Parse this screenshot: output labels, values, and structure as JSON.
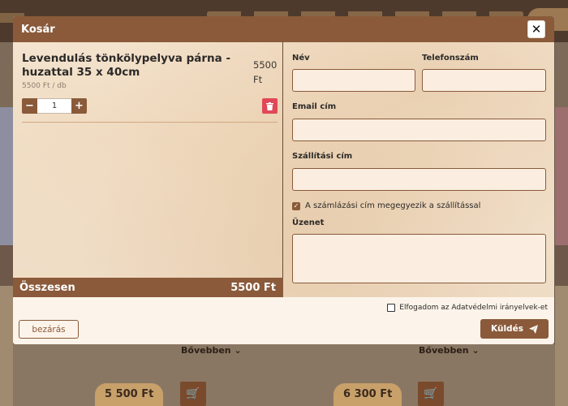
{
  "modal": {
    "title": "Kosár",
    "close_icon": "close-icon",
    "close_glyph": "✕"
  },
  "cart": {
    "item": {
      "name": "Levendulás tönkölypelyva párna - huzattal 35 x 40cm",
      "price": "5500 Ft",
      "unit_price": "5500 Ft / db",
      "quantity": "1",
      "minus_label": "−",
      "plus_label": "+",
      "delete_icon": "trash-icon"
    },
    "total_label": "Összesen",
    "total_value": "5500 Ft"
  },
  "form": {
    "name_label": "Név",
    "phone_label": "Telefonszám",
    "email_label": "Email cím",
    "shipping_label": "Szállítási cím",
    "billing_same_label": "A számlázási cím megegyezik a szállítással",
    "billing_same_checked": true,
    "message_label": "Üzenet"
  },
  "footer": {
    "privacy_label": "Elfogadom az Adatvédelmi irányelvek-et",
    "privacy_checked": false,
    "close_label": "bezárás",
    "send_label": "Küldés",
    "send_icon": "paper-plane-icon"
  },
  "background": {
    "prices": [
      "5 500 Ft",
      "6 300 Ft"
    ],
    "more_label": "Bővebben",
    "cart_icon": "cart-icon"
  },
  "colors": {
    "accent": "#8a5a3a",
    "danger": "#e04858",
    "modal_bg": "#fcf4ea"
  }
}
